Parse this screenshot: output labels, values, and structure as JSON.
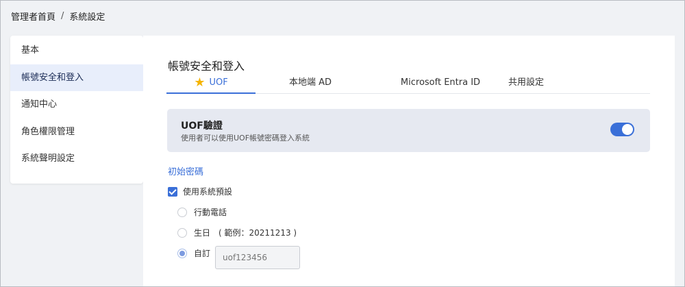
{
  "breadcrumb": {
    "home": "管理者首頁",
    "separator": "/",
    "current": "系統設定"
  },
  "sidebar": {
    "items": [
      {
        "label": "基本"
      },
      {
        "label": "帳號安全和登入"
      },
      {
        "label": "通知中心"
      },
      {
        "label": "角色權限管理"
      },
      {
        "label": "系統聲明設定"
      }
    ],
    "active_index": 1
  },
  "section": {
    "title": "帳號安全和登入"
  },
  "tabs": [
    {
      "label": "UOF",
      "icon": "star-icon"
    },
    {
      "label": "本地端 AD"
    },
    {
      "label": "Microsoft Entra ID"
    },
    {
      "label": "共用設定"
    }
  ],
  "uof_card": {
    "title": "UOF驗證",
    "description": "使用者可以使用UOF帳號密碼登入系統",
    "enabled": true
  },
  "initial_password": {
    "title": "初始密碼",
    "use_default_label": "使用系統預設",
    "use_default_checked": true,
    "options": [
      {
        "label": "行動電話"
      },
      {
        "label": "生日",
        "example": "( 範例：20211213 )"
      },
      {
        "label": "自訂"
      }
    ],
    "selected_option": 2,
    "custom_value": "uof123456"
  },
  "colors": {
    "accent": "#3a6fd8",
    "star": "#f5b400",
    "card_bg": "#e6e9f1"
  }
}
